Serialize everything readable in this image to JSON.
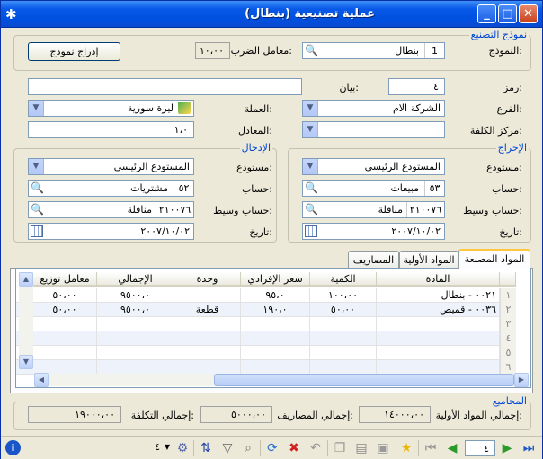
{
  "window": {
    "title": "عملية تصنيعية (بنطال)"
  },
  "template": {
    "legend": "نموذج التصنيع",
    "model_label": "النموذج:",
    "model_code": "1",
    "model_name": "بنطال",
    "multiplier_label": "معامل الضرب:",
    "multiplier": "١٠،٠٠",
    "insert_button": "إدراج نموذج"
  },
  "header": {
    "code_label": "رمز:",
    "code": "٤",
    "statement_label": "بيان:",
    "statement": "",
    "branch_label": "الفرع:",
    "branch": "الشركة الام",
    "currency_label": "العملة:",
    "currency": "ليرة سورية",
    "cost_center_label": "مركز الكلفة:",
    "cost_center": "",
    "rate_label": "المعادل:",
    "rate": "١،٠"
  },
  "output": {
    "legend": "الإخراج",
    "warehouse_label": "مستودع:",
    "warehouse": "المستودع الرئيسي",
    "account_label": "حساب:",
    "account_code": "٥٣",
    "account_name": "مبيعات",
    "mid_account_label": "حساب وسيط:",
    "mid_account_code": "٢١٠٠٧٦",
    "mid_account_name": "مناقلة",
    "date_label": "تاريخ:",
    "date": "٢٠٠٧/١٠/٠٢"
  },
  "input": {
    "legend": "الإدخال",
    "warehouse_label": "مستودع:",
    "warehouse": "المستودع الرئيسي",
    "account_label": "حساب:",
    "account_code": "٥٢",
    "account_name": "مشتريات",
    "mid_account_label": "حساب وسيط:",
    "mid_account_code": "٢١٠٠٧٦",
    "mid_account_name": "مناقلة",
    "date_label": "تاريخ:",
    "date": "٢٠٠٧/١٠/٠٢"
  },
  "tabs": [
    "المواد المصنعة",
    "المواد الأولية",
    "المصاريف"
  ],
  "grid": {
    "columns": [
      "المادة",
      "الكمية",
      "سعر الإفرادي",
      "وحدة",
      "الإجمالي",
      "معامل توزيع"
    ],
    "rows": [
      {
        "n": "١",
        "item": "٠٠٢١ - بنطال",
        "qty": "١٠٠،٠٠",
        "price": "٩٥،٠",
        "unit": "",
        "total": "٩٥٠٠،٠",
        "dist": "٥٠،٠٠"
      },
      {
        "n": "٢",
        "item": "٠٠٣٦ - قميص",
        "qty": "٥٠،٠٠",
        "price": "١٩٠،٠",
        "unit": "قطعة",
        "total": "٩٥٠٠،٠",
        "dist": "٥٠،٠٠"
      },
      {
        "n": "٣",
        "item": "",
        "qty": "",
        "price": "",
        "unit": "",
        "total": "",
        "dist": ""
      },
      {
        "n": "٤",
        "item": "",
        "qty": "",
        "price": "",
        "unit": "",
        "total": "",
        "dist": ""
      },
      {
        "n": "٥",
        "item": "",
        "qty": "",
        "price": "",
        "unit": "",
        "total": "",
        "dist": ""
      },
      {
        "n": "٦",
        "item": "",
        "qty": "",
        "price": "",
        "unit": "",
        "total": "",
        "dist": ""
      }
    ]
  },
  "totals": {
    "legend": "المجاميع",
    "raw_label": "إجمالي المواد الأولية:",
    "raw": "١٤٠٠٠،٠٠",
    "exp_label": "إجمالي المصاريف:",
    "exp": "٥٠٠٠،٠٠",
    "cost_label": "إجمالي التكلفة:",
    "cost": "١٩٠٠٠،٠٠"
  },
  "nav": {
    "record": "٤",
    "count_value": "٤"
  }
}
